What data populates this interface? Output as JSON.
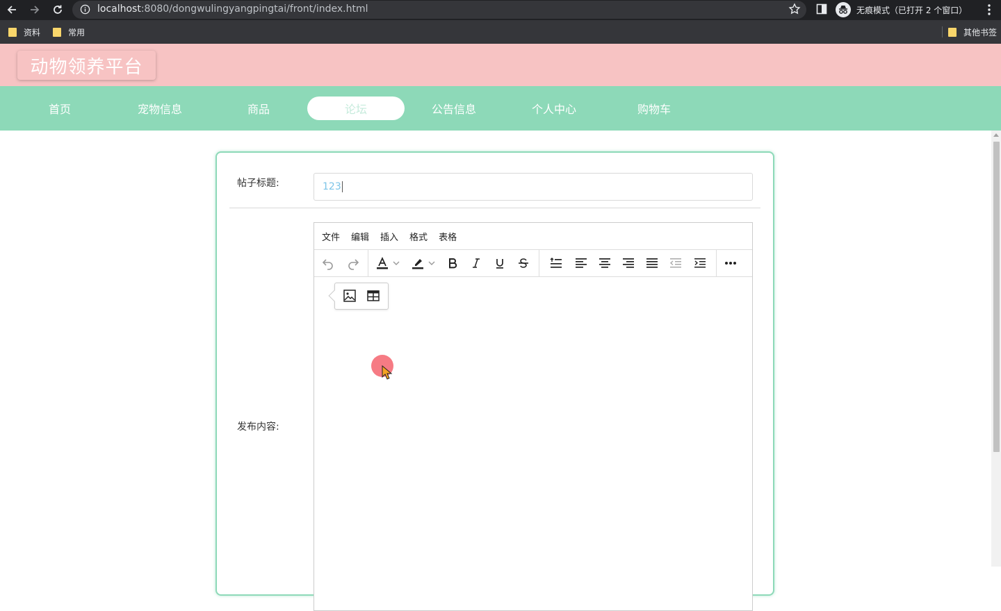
{
  "browser": {
    "url_host": "localhost",
    "url_rest": ":8080/dongwulingyangpingtai/front/index.html",
    "incognito_label": "无痕模式（已打开 2 个窗口）",
    "bookmarks": [
      "资料",
      "常用"
    ],
    "other_bookmarks": "其他书签"
  },
  "site": {
    "logo": "动物领养平台",
    "nav": [
      {
        "label": "首页",
        "active": false
      },
      {
        "label": "宠物信息",
        "active": false
      },
      {
        "label": "商品",
        "active": false
      },
      {
        "label": "论坛",
        "active": true
      },
      {
        "label": "公告信息",
        "active": false
      },
      {
        "label": "个人中心",
        "active": false
      },
      {
        "label": "购物车",
        "active": false
      }
    ]
  },
  "form": {
    "title_label": "帖子标题:",
    "title_value": "123",
    "content_label": "发布内容:"
  },
  "editor": {
    "menu": [
      "文件",
      "编辑",
      "插入",
      "格式",
      "表格"
    ]
  },
  "colors": {
    "header_bg": "#f7c3c3",
    "nav_bg": "#8dd9b8",
    "card_border": "#8dd9b8"
  }
}
